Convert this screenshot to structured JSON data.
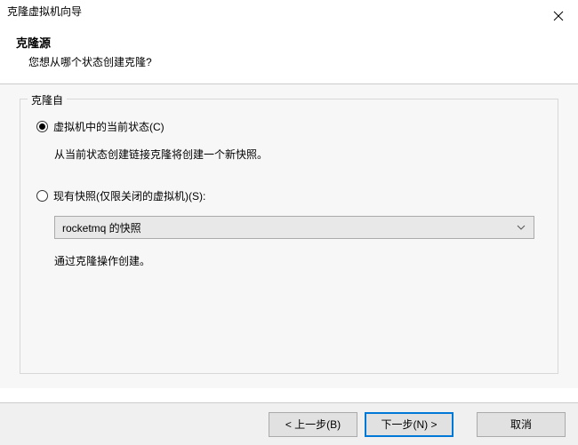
{
  "titlebar": {
    "title": "克隆虚拟机向导"
  },
  "header": {
    "title": "克隆源",
    "subtitle": "您想从哪个状态创建克隆?"
  },
  "fieldset": {
    "legend": "克隆自"
  },
  "option_current": {
    "label": "虚拟机中的当前状态(C)",
    "desc": "从当前状态创建链接克隆将创建一个新快照。"
  },
  "option_snapshot": {
    "label": "现有快照(仅限关闭的虚拟机)(S):",
    "dropdown_value": "rocketmq 的快照",
    "desc": "通过克隆操作创建。"
  },
  "buttons": {
    "back": "< 上一步(B)",
    "next": "下一步(N) >",
    "cancel": "取消"
  }
}
